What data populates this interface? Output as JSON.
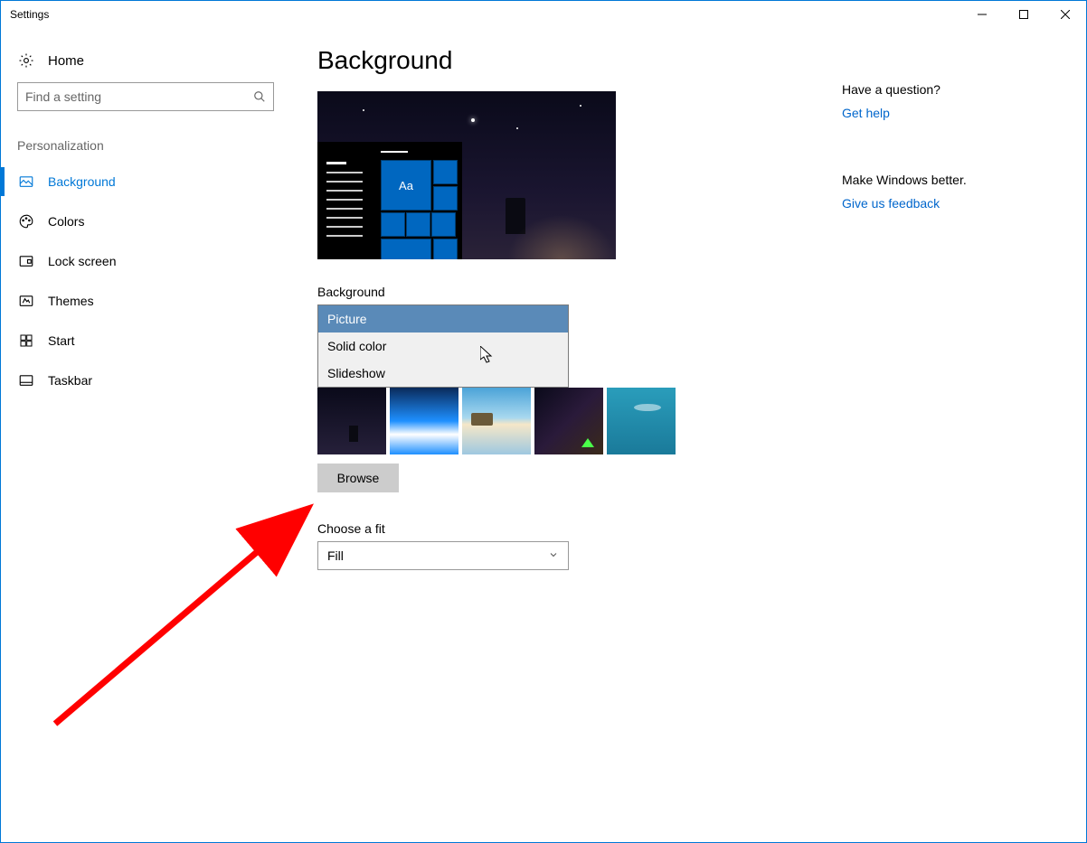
{
  "window": {
    "title": "Settings"
  },
  "sidebar": {
    "home_label": "Home",
    "search_placeholder": "Find a setting",
    "section_label": "Personalization",
    "items": [
      {
        "label": "Background"
      },
      {
        "label": "Colors"
      },
      {
        "label": "Lock screen"
      },
      {
        "label": "Themes"
      },
      {
        "label": "Start"
      },
      {
        "label": "Taskbar"
      }
    ]
  },
  "main": {
    "title": "Background",
    "preview_tile_text": "Aa",
    "background_label": "Background",
    "background_options": [
      "Picture",
      "Solid color",
      "Slideshow"
    ],
    "background_selected": "Picture",
    "browse_label": "Browse",
    "fit_label": "Choose a fit",
    "fit_selected": "Fill"
  },
  "rail": {
    "question": "Have a question?",
    "help_link": "Get help",
    "better": "Make Windows better.",
    "feedback_link": "Give us feedback"
  }
}
